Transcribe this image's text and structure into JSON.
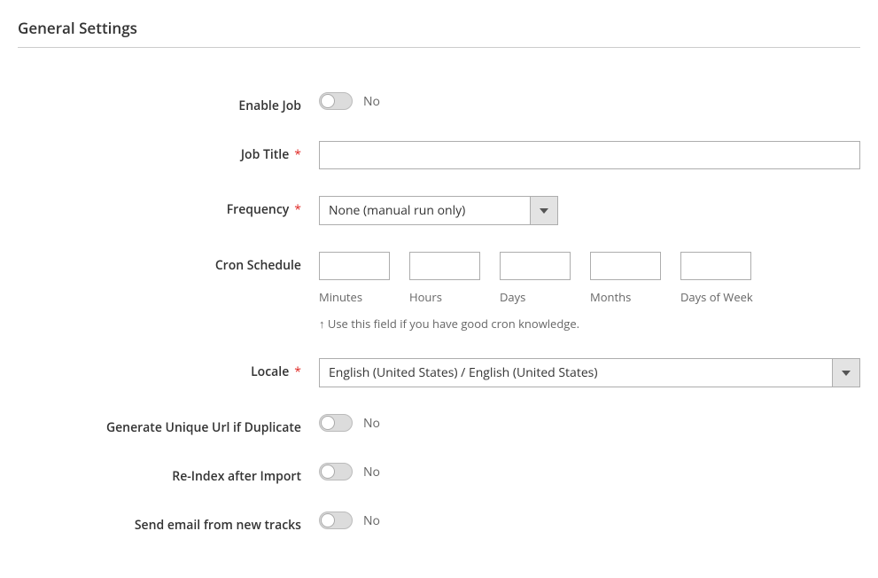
{
  "section": {
    "title": "General Settings"
  },
  "fields": {
    "enable_job": {
      "label": "Enable Job",
      "value_text": "No"
    },
    "job_title": {
      "label": "Job Title",
      "value": ""
    },
    "frequency": {
      "label": "Frequency",
      "selected": "None (manual run only)"
    },
    "cron_schedule": {
      "label": "Cron Schedule",
      "sublabels": {
        "minutes": "Minutes",
        "hours": "Hours",
        "days": "Days",
        "months": "Months",
        "days_of_week": "Days of Week"
      },
      "note": "↑ Use this field if you have good cron knowledge."
    },
    "locale": {
      "label": "Locale",
      "selected": "English (United States) / English (United States)"
    },
    "generate_unique_url": {
      "label": "Generate Unique Url if Duplicate",
      "value_text": "No"
    },
    "reindex": {
      "label": "Re-Index after Import",
      "value_text": "No"
    },
    "send_email": {
      "label": "Send email from new tracks",
      "value_text": "No"
    }
  }
}
